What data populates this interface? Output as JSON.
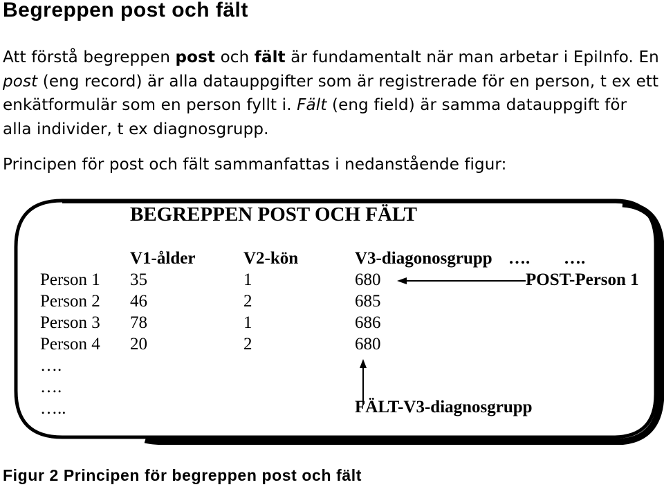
{
  "heading": "Begreppen post och fält",
  "intro": {
    "part1": "Att förstå begreppen ",
    "bold1": "post",
    "part2": " och ",
    "bold2": "fält",
    "part3": " är fundamentalt när man arbetar i EpiInfo. En ",
    "italic1": "post",
    "part4": " (eng record) är alla datauppgifter som är registrerade för en person, t ex ett enkätformulär som en person fyllt i. ",
    "italic2": "Fält",
    "part5": " (eng field) är samma datauppgift för alla individer, t ex diagnosgrupp."
  },
  "summary": "Principen för post och fält sammanfattas i nedanstående figur:",
  "figure": {
    "title": "BEGREPPEN POST OCH FÄLT",
    "columns": [
      "V1-ålder",
      "V2-kön",
      "V3-diagonosgrupp",
      "….",
      "…."
    ],
    "rows": [
      {
        "label": "Person 1",
        "v1": "35",
        "v2": "1",
        "v3": "680"
      },
      {
        "label": "Person 2",
        "v1": "46",
        "v2": "2",
        "v3": "685"
      },
      {
        "label": "Person 3",
        "v1": "78",
        "v2": "1",
        "v3": "686"
      },
      {
        "label": "Person 4",
        "v1": "20",
        "v2": "2",
        "v3": "680"
      }
    ],
    "ellipsis_rows": [
      "….",
      "….",
      "….."
    ],
    "post_label": "POST-Person 1",
    "field_label": "FÄLT-V3-diagnosgrupp"
  },
  "caption": "Figur 2 Principen för begreppen post och fält"
}
